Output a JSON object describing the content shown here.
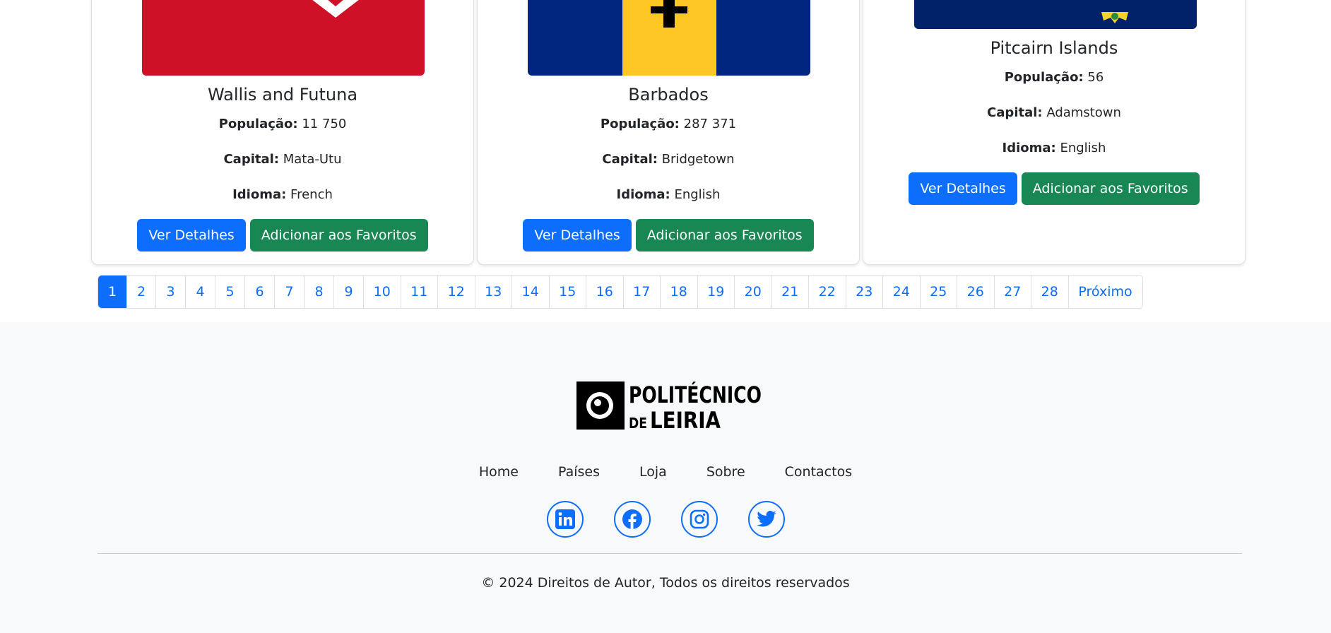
{
  "cards": [
    {
      "name": "Wallis and Futuna",
      "population_label": "População:",
      "population": "11 750",
      "capital_label": "Capital:",
      "capital": "Mata-Utu",
      "language_label": "Idioma:",
      "language": "French",
      "details_label": "Ver Detalhes",
      "favorites_label": "Adicionar aos Favoritos"
    },
    {
      "name": "Barbados",
      "population_label": "População:",
      "population": "287 371",
      "capital_label": "Capital:",
      "capital": "Bridgetown",
      "language_label": "Idioma:",
      "language": "English",
      "details_label": "Ver Detalhes",
      "favorites_label": "Adicionar aos Favoritos"
    },
    {
      "name": "Pitcairn Islands",
      "population_label": "População:",
      "population": "56",
      "capital_label": "Capital:",
      "capital": "Adamstown",
      "language_label": "Idioma:",
      "language": "English",
      "details_label": "Ver Detalhes",
      "favorites_label": "Adicionar aos Favoritos"
    }
  ],
  "pagination": {
    "pages": [
      "1",
      "2",
      "3",
      "4",
      "5",
      "6",
      "7",
      "8",
      "9",
      "10",
      "11",
      "12",
      "13",
      "14",
      "15",
      "16",
      "17",
      "18",
      "19",
      "20",
      "21",
      "22",
      "23",
      "24",
      "25",
      "26",
      "27",
      "28"
    ],
    "active": "1",
    "next_label": "Próximo"
  },
  "footer": {
    "logo_line1": "POLITÉCNICO",
    "logo_line2_small": "DE",
    "logo_line2_big": "LEIRIA",
    "nav": [
      "Home",
      "Países",
      "Loja",
      "Sobre",
      "Contactos"
    ],
    "social_icons": [
      "linkedin-icon",
      "facebook-icon",
      "instagram-icon",
      "twitter-icon"
    ],
    "copyright": "© 2024 Direitos de Autor, Todos os direitos reservados"
  },
  "colors": {
    "primary": "#0d6efd",
    "success": "#198754",
    "footer_bg": "#f8f9fa",
    "wallis_red": "#ce1126",
    "barbados_blue": "#00267f",
    "barbados_gold": "#ffc726",
    "pitcairn_blue": "#012169"
  }
}
